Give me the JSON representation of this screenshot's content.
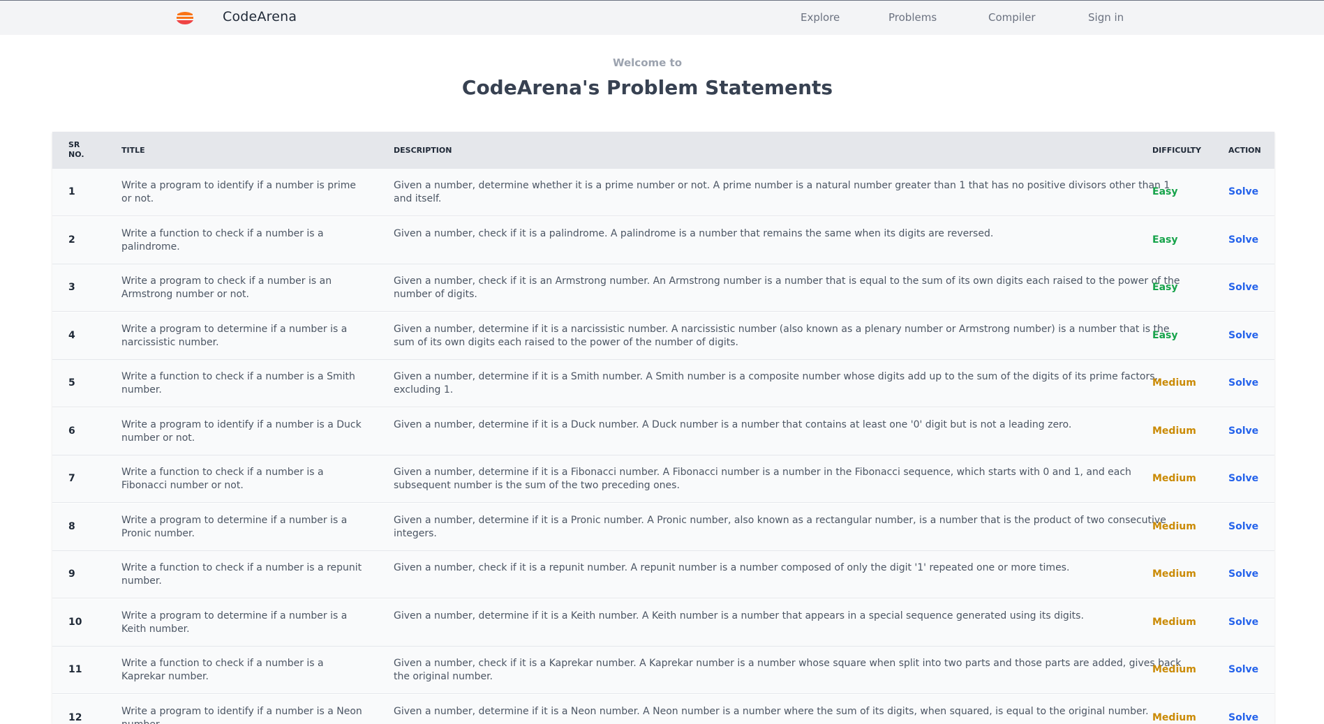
{
  "nav": {
    "brand": "CodeArena",
    "links": [
      "Explore",
      "Problems",
      "Compiler",
      "Sign in"
    ]
  },
  "hero": {
    "welcome": "Welcome to",
    "title": "CodeArena's Problem Statements"
  },
  "table": {
    "headers": {
      "sr": "SR NO.",
      "title": "TITLE",
      "description": "DESCRIPTION",
      "difficulty": "DIFFICULTY",
      "action": "ACTION"
    },
    "rows": [
      {
        "sr": "1",
        "title": "Write a program to identify if a number is prime or not.",
        "description": "Given a number, determine whether it is a prime number or not. A prime number is a natural number greater than 1 that has no positive divisors other than 1 and itself.",
        "difficulty": "Easy",
        "action": "Solve"
      },
      {
        "sr": "2",
        "title": "Write a function to check if a number is a palindrome.",
        "description": "Given a number, check if it is a palindrome. A palindrome is a number that remains the same when its digits are reversed.",
        "difficulty": "Easy",
        "action": "Solve"
      },
      {
        "sr": "3",
        "title": "Write a program to check if a number is an Armstrong number or not.",
        "description": "Given a number, check if it is an Armstrong number. An Armstrong number is a number that is equal to the sum of its own digits each raised to the power of the number of digits.",
        "difficulty": "Easy",
        "action": "Solve"
      },
      {
        "sr": "4",
        "title": "Write a program to determine if a number is a narcissistic number.",
        "description": "Given a number, determine if it is a narcissistic number. A narcissistic number (also known as a plenary number or Armstrong number) is a number that is the sum of its own digits each raised to the power of the number of digits.",
        "difficulty": "Easy",
        "action": "Solve"
      },
      {
        "sr": "5",
        "title": "Write a function to check if a number is a Smith number.",
        "description": "Given a number, determine if it is a Smith number. A Smith number is a composite number whose digits add up to the sum of the digits of its prime factors, excluding 1.",
        "difficulty": "Medium",
        "action": "Solve"
      },
      {
        "sr": "6",
        "title": "Write a program to identify if a number is a Duck number or not.",
        "description": "Given a number, determine if it is a Duck number. A Duck number is a number that contains at least one '0' digit but is not a leading zero.",
        "difficulty": "Medium",
        "action": "Solve"
      },
      {
        "sr": "7",
        "title": "Write a function to check if a number is a Fibonacci number or not.",
        "description": "Given a number, determine if it is a Fibonacci number. A Fibonacci number is a number in the Fibonacci sequence, which starts with 0 and 1, and each subsequent number is the sum of the two preceding ones.",
        "difficulty": "Medium",
        "action": "Solve"
      },
      {
        "sr": "8",
        "title": "Write a program to determine if a number is a Pronic number.",
        "description": "Given a number, determine if it is a Pronic number. A Pronic number, also known as a rectangular number, is a number that is the product of two consecutive integers.",
        "difficulty": "Medium",
        "action": "Solve"
      },
      {
        "sr": "9",
        "title": "Write a function to check if a number is a repunit number.",
        "description": "Given a number, check if it is a repunit number. A repunit number is a number composed of only the digit '1' repeated one or more times.",
        "difficulty": "Medium",
        "action": "Solve"
      },
      {
        "sr": "10",
        "title": "Write a program to determine if a number is a Keith number.",
        "description": "Given a number, determine if it is a Keith number. A Keith number is a number that appears in a special sequence generated using its digits.",
        "difficulty": "Medium",
        "action": "Solve"
      },
      {
        "sr": "11",
        "title": "Write a function to check if a number is a Kaprekar number.",
        "description": "Given a number, check if it is a Kaprekar number. A Kaprekar number is a number whose square when split into two parts and those parts are added, gives back the original number.",
        "difficulty": "Medium",
        "action": "Solve"
      },
      {
        "sr": "12",
        "title": "Write a program to identify if a number is a Neon number.",
        "description": "Given a number, determine if it is a Neon number. A Neon number is a number where the sum of its digits, when squared, is equal to the original number.",
        "difficulty": "Medium",
        "action": "Solve"
      }
    ]
  },
  "colors": {
    "easy": "#16a34a",
    "medium": "#ca8a04",
    "link": "#2563eb",
    "logo_orange": "#f97316",
    "logo_red": "#ef4444"
  }
}
